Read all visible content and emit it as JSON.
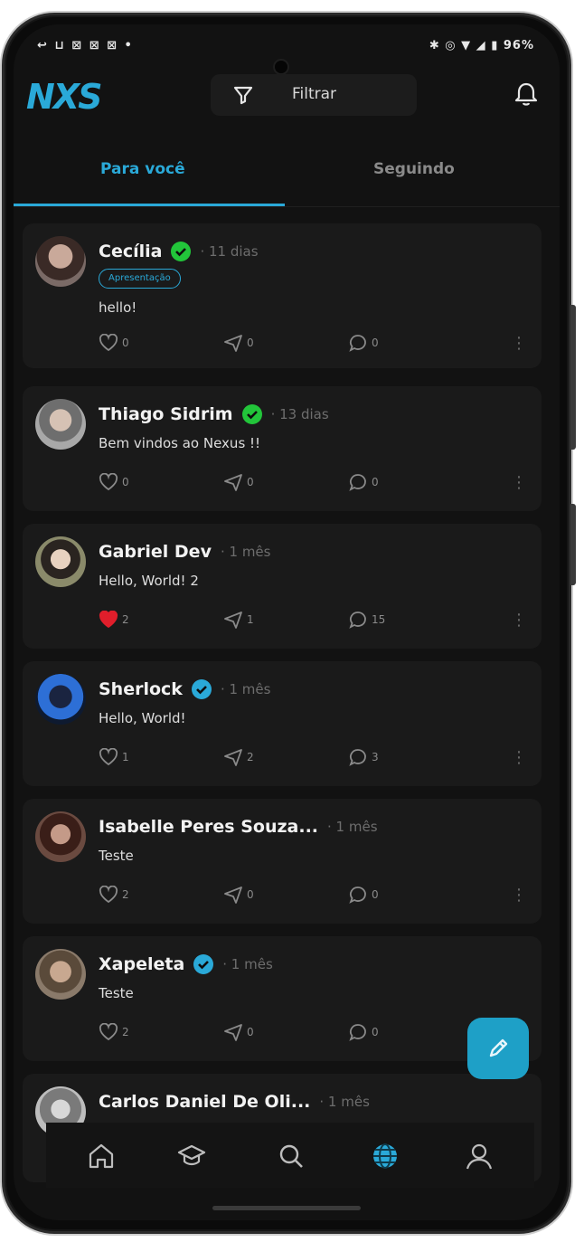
{
  "status_bar": {
    "left_icons": "↩ ⊔ ⊠ ⊠ ⊠ •",
    "right_icons": "✱ ◎ ▼ ◢ ▮ 96%"
  },
  "header": {
    "logo": "NXS",
    "filter_label": "Filtrar"
  },
  "tabs": [
    {
      "label": "Para você",
      "active": true
    },
    {
      "label": "Seguindo",
      "active": false
    }
  ],
  "colors": {
    "accent": "#2aa9d8",
    "verified_green": "#22c53a",
    "verified_blue": "#2aa9d8",
    "liked_red": "#e01e2b"
  },
  "posts": [
    {
      "name": "Cecília",
      "verified": "green",
      "time": "· 11 dias",
      "tag": "Apresentação",
      "text": "hello!",
      "likes": "0",
      "shares": "0",
      "comments": "0",
      "liked": false
    },
    {
      "name": "Thiago Sidrim",
      "verified": "green",
      "time": "· 13 dias",
      "text": "Bem vindos ao Nexus !!",
      "likes": "0",
      "shares": "0",
      "comments": "0",
      "liked": false
    },
    {
      "name": "Gabriel Dev",
      "verified": "none",
      "time": "· 1 mês",
      "text": "Hello, World! 2",
      "likes": "2",
      "shares": "1",
      "comments": "15",
      "liked": true
    },
    {
      "name": "Sherlock",
      "verified": "blue",
      "time": "· 1 mês",
      "text": "Hello, World!",
      "likes": "1",
      "shares": "2",
      "comments": "3",
      "liked": false
    },
    {
      "name": "Isabelle Peres Souza...",
      "verified": "none",
      "time": "· 1 mês",
      "text": "Teste",
      "likes": "2",
      "shares": "0",
      "comments": "0",
      "liked": false
    },
    {
      "name": "Xapeleta",
      "verified": "blue",
      "time": "· 1 mês",
      "text": "Teste",
      "likes": "2",
      "shares": "0",
      "comments": "0",
      "liked": false
    },
    {
      "name": "Carlos Daniel De Oli...",
      "verified": "none",
      "time": "· 1 mês"
    }
  ],
  "more_glyph": "⋮",
  "bottom_nav": [
    "home-icon",
    "graduation-cap-icon",
    "search-icon",
    "globe-icon",
    "profile-icon"
  ],
  "fab_icon": "pencil-icon"
}
